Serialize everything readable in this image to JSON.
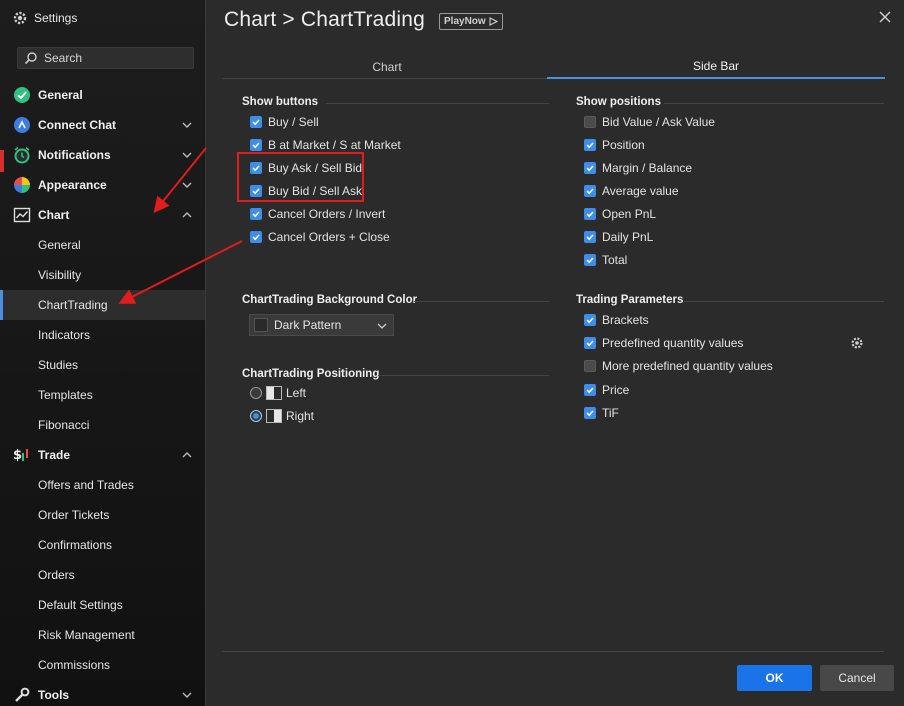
{
  "sidebar": {
    "title": "Settings",
    "search_placeholder": "Search",
    "items": [
      {
        "label": "General"
      },
      {
        "label": "Connect Chat"
      },
      {
        "label": "Notifications"
      },
      {
        "label": "Appearance"
      },
      {
        "label": "Chart"
      },
      {
        "label": "Trade"
      },
      {
        "label": "Tools"
      }
    ],
    "chart_sub": [
      "General",
      "Visibility",
      "ChartTrading",
      "Indicators",
      "Studies",
      "Templates",
      "Fibonacci"
    ],
    "trade_sub": [
      "Offers and Trades",
      "Order Tickets",
      "Confirmations",
      "Orders",
      "Default Settings",
      "Risk Management",
      "Commissions"
    ]
  },
  "header": {
    "title": "Chart > ChartTrading",
    "playnow": "PlayNow"
  },
  "tabs": [
    {
      "label": "Chart",
      "active": false
    },
    {
      "label": "Side Bar",
      "active": true
    }
  ],
  "show_buttons": {
    "title": "Show buttons",
    "items": [
      {
        "label": "Buy / Sell",
        "checked": true
      },
      {
        "label": "B at Market / S at Market",
        "checked": true
      },
      {
        "label": "Buy Ask / Sell Bid",
        "checked": true
      },
      {
        "label": "Buy Bid / Sell Ask",
        "checked": true
      },
      {
        "label": "Cancel Orders / Invert",
        "checked": true
      },
      {
        "label": "Cancel Orders + Close",
        "checked": true
      }
    ]
  },
  "show_positions": {
    "title": "Show positions",
    "items": [
      {
        "label": "Bid Value / Ask Value",
        "checked": false
      },
      {
        "label": "Position",
        "checked": true
      },
      {
        "label": "Margin / Balance",
        "checked": true
      },
      {
        "label": "Average value",
        "checked": true
      },
      {
        "label": "Open PnL",
        "checked": true
      },
      {
        "label": "Daily PnL",
        "checked": true
      },
      {
        "label": "Total",
        "checked": true
      }
    ]
  },
  "background_color": {
    "title": "ChartTrading Background Color",
    "value": "Dark Pattern"
  },
  "positioning": {
    "title": "ChartTrading Positioning",
    "options": [
      {
        "label": "Left",
        "selected": false
      },
      {
        "label": "Right",
        "selected": true
      }
    ]
  },
  "trading_parameters": {
    "title": "Trading Parameters",
    "items": [
      {
        "label": "Brackets",
        "checked": true
      },
      {
        "label": "Predefined quantity values",
        "checked": true
      },
      {
        "label": "More predefined quantity values",
        "checked": false
      },
      {
        "label": "Price",
        "checked": true
      },
      {
        "label": "TiF",
        "checked": true
      }
    ]
  },
  "footer": {
    "ok": "OK",
    "cancel": "Cancel"
  },
  "colors": {
    "accent": "#1a73e8",
    "highlight": "#e01c1c"
  }
}
